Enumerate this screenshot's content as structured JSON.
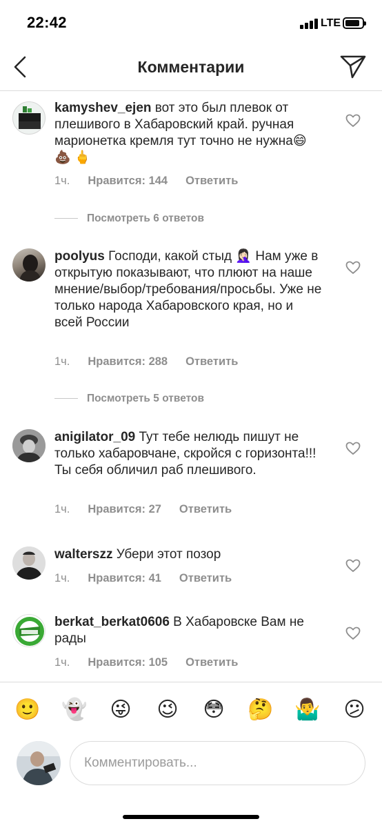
{
  "status_bar": {
    "time": "22:42",
    "network": "LTE"
  },
  "header": {
    "title": "Комментарии"
  },
  "comments": [
    {
      "username": "kamyshev_ejen",
      "text": "вот это был плевок от плешивого в Хабаровский край. ручная марионетка кремля тут точно не нужна😄 💩 🖕",
      "time": "1ч.",
      "likes": "Нравится: 144",
      "reply": "Ответить",
      "avatar_text": "СЕРГЕЙ ФУРГАЛ",
      "view_replies": "Посмотреть 6 ответов"
    },
    {
      "username": "poolyus",
      "text": "Господи, какой стыд 🤦🏻‍♀️ Нам уже в открытую показывают, что плюют на наше мнение/выбор/требования/просьбы. Уже не только народа Хабаровского края, но и всей России",
      "time": "1ч.",
      "likes": "Нравится: 288",
      "reply": "Ответить",
      "view_replies": "Посмотреть 5 ответов"
    },
    {
      "username": "anigilator_09",
      "text": "Тут тебе нелюдь пишут не только хабаровчане, скройся с горизонта!!! Ты себя обличил раб плешивого.",
      "time": "1ч.",
      "likes": "Нравится: 27",
      "reply": "Ответить"
    },
    {
      "username": "walterszz",
      "text": "Убери этот позор",
      "time": "1ч.",
      "likes": "Нравится: 41",
      "reply": "Ответить"
    },
    {
      "username": "berkat_berkat0606",
      "text": "В Хабаровске Вам не рады",
      "time": "1ч.",
      "likes": "Нравится: 105",
      "reply": "Ответить",
      "avatar_text": "БЕРКАТ"
    }
  ],
  "emoji_bar": [
    "🙂",
    "👻",
    "😜",
    "😉",
    "😳",
    "🤔",
    "🤷‍♂️",
    "😕"
  ],
  "compose": {
    "placeholder": "Комментировать..."
  },
  "colors": {
    "text": "#262626",
    "meta": "#8e8e8e",
    "divider": "#dbdbdb"
  }
}
